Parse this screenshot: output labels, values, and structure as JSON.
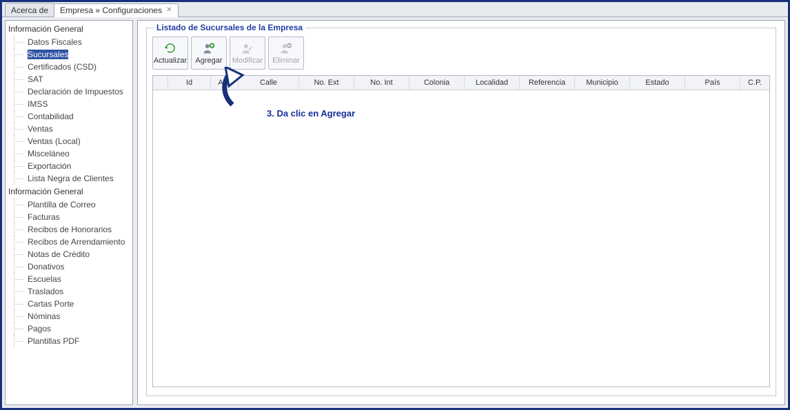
{
  "tabs": {
    "acerca": "Acerca de",
    "current": "Empresa » Configuraciones"
  },
  "tree": {
    "group1_label": "Información General",
    "group1_items": [
      "Datos Fiscales",
      "Sucursales",
      "Certificados (CSD)",
      "SAT",
      "Declaración de Impuestos",
      "IMSS",
      "Contabilidad",
      "Ventas",
      "Ventas (Local)",
      "Misceláneo",
      "Exportación",
      "Lista Negra de Clientes"
    ],
    "group2_label": "Información General",
    "group2_items": [
      "Plantilla de Correo",
      "Facturas",
      "Recibos de Honorarios",
      "Recibos de Arrendamiento",
      "Notas de Crédito",
      "Donativos",
      "Escuelas",
      "Traslados",
      "Cartas Porte",
      "Nóminas",
      "Pagos",
      "Plantillas PDF"
    ]
  },
  "panel": {
    "group_title": "Listado de Sucursales de la Empresa",
    "toolbar": {
      "refresh": "Actualizar",
      "add": "Agregar",
      "edit": "Modificar",
      "delete": "Eliminar"
    },
    "annotation": "3. Da clic en Agregar",
    "grid_columns": [
      "Id",
      "A…",
      "Calle",
      "No. Ext",
      "No. Int",
      "Colonia",
      "Localidad",
      "Referencia",
      "Municipio",
      "Estado",
      "País",
      "C.P."
    ]
  }
}
